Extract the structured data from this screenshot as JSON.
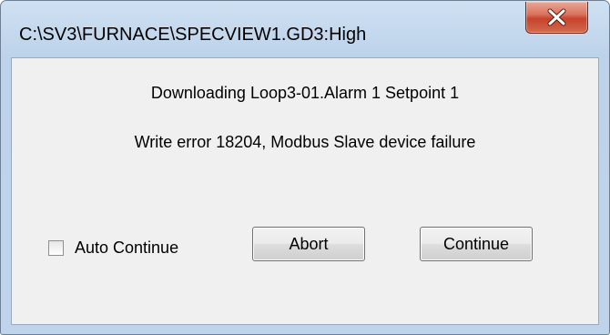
{
  "window": {
    "title": "C:\\SV3\\FURNACE\\SPECVIEW1.GD3:High",
    "close_icon": "close-x-icon"
  },
  "message": {
    "line1": "Downloading Loop3-01.Alarm 1 Setpoint 1",
    "line2": "Write error 18204, Modbus Slave device failure"
  },
  "auto_continue": {
    "label": "Auto Continue",
    "checked": false
  },
  "buttons": {
    "abort_label": "Abort",
    "continue_label": "Continue"
  },
  "colors": {
    "title_frame": "#bfd4ea",
    "close_button": "#c7432c",
    "client_background": "#f0f0f0"
  }
}
